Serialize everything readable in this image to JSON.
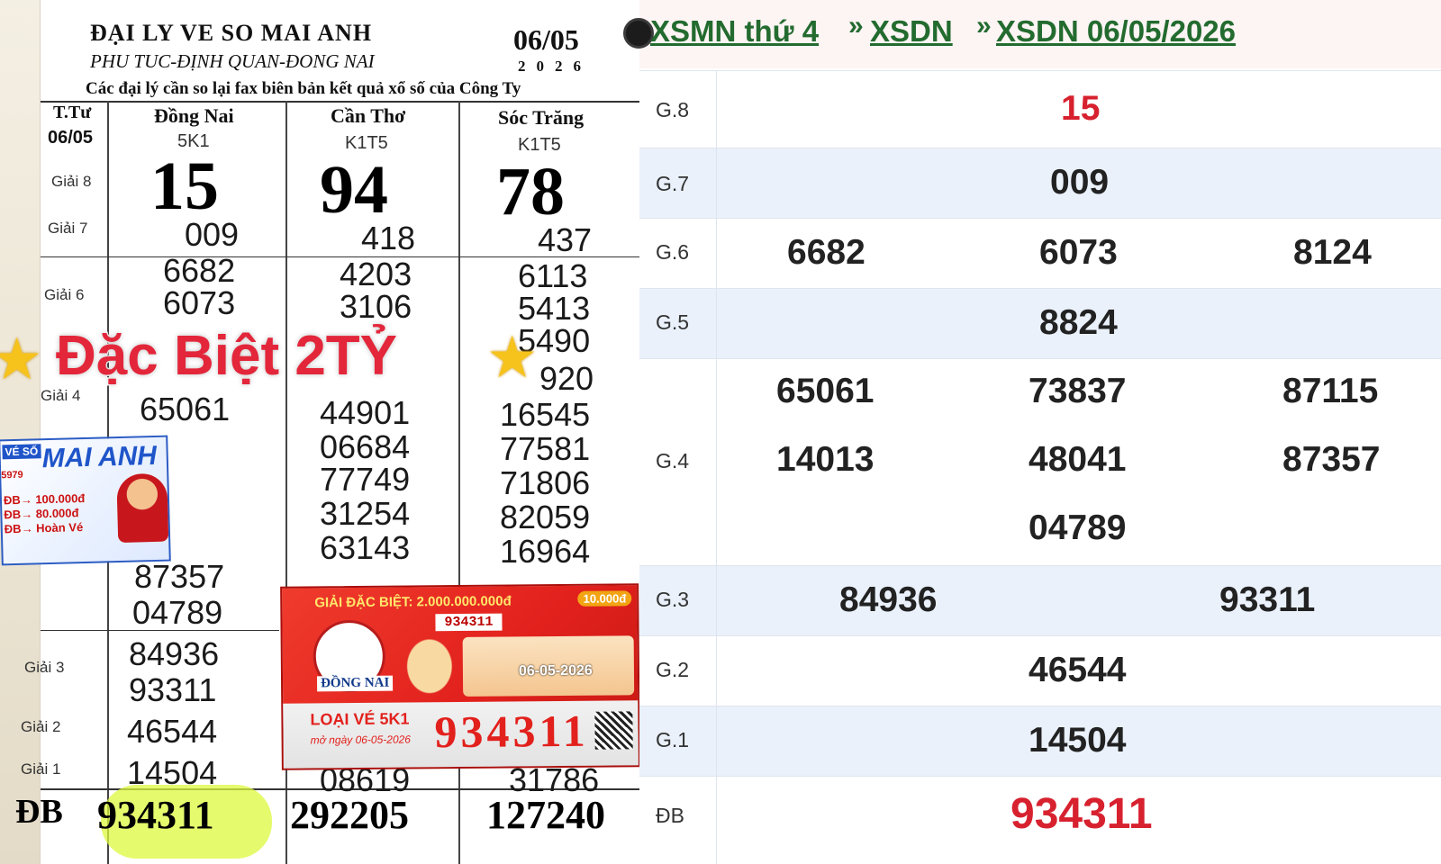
{
  "photo": {
    "agency_title": "ĐẠI LY VE SO MAI ANH",
    "agency_address": "PHU TUC-ĐỊNH QUAN-ĐONG NAI",
    "date": "06/05",
    "year": "2026",
    "notice": "Các đại lý cần so lại fax biên bản kết quả xổ số của Công Ty",
    "weekday_label": "T.Tư",
    "weekday_date": "06/05",
    "columns": [
      {
        "name": "Đồng Nai",
        "code": "5K1"
      },
      {
        "name": "Cần Thơ",
        "code": "K1T5"
      },
      {
        "name": "Sóc Trăng",
        "code": "K1T5"
      }
    ],
    "prize_labels": {
      "g8": "Giải 8",
      "g7": "Giải 7",
      "g6": "Giải 6",
      "g4": "Giải 4",
      "g3": "Giải 3",
      "g2": "Giải 2",
      "g1": "Giải 1",
      "db": "ĐB"
    },
    "g8": [
      "15",
      "94",
      "78"
    ],
    "g7": [
      "009",
      "418",
      "437"
    ],
    "g6": [
      [
        "6682",
        "6073"
      ],
      [
        "4203",
        "3106"
      ],
      [
        "6113",
        "5413",
        "5490"
      ]
    ],
    "col2_lower": [
      "44901",
      "06684",
      "77749",
      "31254",
      "63143"
    ],
    "col3_lower": [
      "920",
      "16545",
      "77581",
      "71806",
      "82059",
      "16964"
    ],
    "col1_lower": [
      "65061",
      "87357",
      "04789"
    ],
    "g3": [
      "84936",
      "93311"
    ],
    "g2": "46544",
    "g1": [
      "14504",
      "08619",
      "31786"
    ],
    "db": [
      "934311",
      "292205",
      "127240"
    ],
    "overlay_title": "Đặc Biệt 2TỶ",
    "ad_card": {
      "tag": "VÉ SỐ",
      "brand": "MAI ANH",
      "phone": "5979",
      "lines": [
        "ĐB→ 100.000đ",
        "ĐB→ 80.000đ",
        "ĐB→ Hoàn Vé"
      ]
    },
    "ticket": {
      "headline": "GIẢI ĐẶC BIỆT: 2.000.000.000đ",
      "badge": "10.000đ",
      "serial": "934311",
      "province": "ĐỒNG NAI",
      "draw_date": "06-05-2026",
      "type": "LOẠI VÉ 5K1",
      "issue": "mở ngày 06-05-2026",
      "big_serial": "934311"
    }
  },
  "result": {
    "breadcrumb": [
      "XSMN thứ 4",
      "XSDN",
      "XSDN 06/05/2026"
    ],
    "breadcrumb_sep": "»",
    "prizes": [
      {
        "label": "G.8",
        "values": [
          "15"
        ]
      },
      {
        "label": "G.7",
        "values": [
          "009"
        ]
      },
      {
        "label": "G.6",
        "values": [
          "6682",
          "6073",
          "8124"
        ]
      },
      {
        "label": "G.5",
        "values": [
          "8824"
        ]
      },
      {
        "label": "G.4",
        "values": [
          "65061",
          "73837",
          "87115",
          "14013",
          "48041",
          "87357",
          "04789"
        ]
      },
      {
        "label": "G.3",
        "values": [
          "84936",
          "93311"
        ]
      },
      {
        "label": "G.2",
        "values": [
          "46544"
        ]
      },
      {
        "label": "G.1",
        "values": [
          "14504"
        ]
      },
      {
        "label": "ĐB",
        "values": [
          "934311"
        ]
      }
    ],
    "accent_red": "#d7212f",
    "link_green": "#236b2f",
    "stripe_blue": "#eaf1fb"
  }
}
